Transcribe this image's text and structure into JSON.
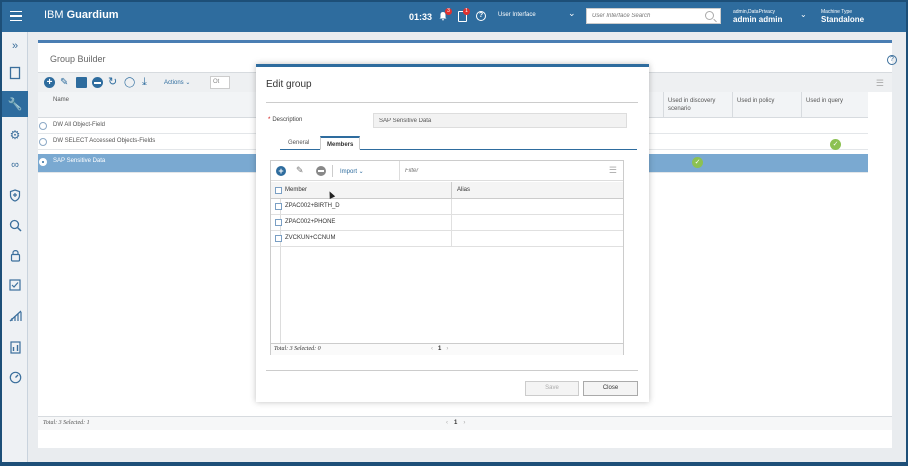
{
  "topbar": {
    "brand_prefix": "IBM ",
    "brand_name": "Guardium",
    "clock": "01:33",
    "bell_badge": "3",
    "tasks_badge": "1",
    "help": "?",
    "ui_select": "User Interface",
    "search_placeholder": "User Interface Search",
    "user_small": "admin,DataPrivacy",
    "user_name": "admin admin",
    "machine_small": "Machine Type",
    "machine_value": "Standalone"
  },
  "sidebar": {
    "icons": [
      "expand-icon",
      "clipboard-icon",
      "wrench-icon",
      "gear-icon",
      "glasses-icon",
      "shield-icon",
      "search-icon",
      "lock-icon",
      "checklist-icon",
      "chart-icon",
      "report-icon",
      "gauge-icon"
    ]
  },
  "group_builder": {
    "title": "Group Builder",
    "help": "?",
    "toolbar": {
      "actions_label": "Actions",
      "filter_stub": "Ot"
    },
    "columns": {
      "name": "Name",
      "discovery": "Used in discovery scenario",
      "policy": "Used in policy",
      "query": "Used in query"
    },
    "rows": [
      {
        "name": "DW All Object-Field"
      },
      {
        "name": "DW SELECT Accessed Objects-Fields"
      },
      {
        "name": "SAP Sensitive Data"
      }
    ],
    "footer": {
      "total": "Total: 3 Selected: 1",
      "page": "1"
    }
  },
  "modal": {
    "title": "Edit group",
    "description_label": "Description",
    "required_mark": "*",
    "description_value": "SAP Sensitive Data",
    "tabs": {
      "general": "General",
      "members": "Members"
    },
    "toolbar": {
      "import_label": "Import",
      "filter_placeholder": "Filter"
    },
    "members_table": {
      "columns": {
        "member": "Member",
        "alias": "Alias"
      },
      "rows": [
        {
          "member": "ZPAC002+BIRTH_D",
          "alias": ""
        },
        {
          "member": "ZPAC002+PHONE",
          "alias": ""
        },
        {
          "member": "ZVCKUN+CCNUM",
          "alias": ""
        }
      ],
      "footer": {
        "total": "Total: 3 Selected: 0",
        "page": "1"
      }
    },
    "buttons": {
      "save": "Save",
      "close": "Close"
    }
  },
  "colors": {
    "brand_blue": "#2e6c9e",
    "selected_row": "#7aa9d1",
    "check_green": "#8cc152",
    "badge_red": "#e0312f"
  }
}
